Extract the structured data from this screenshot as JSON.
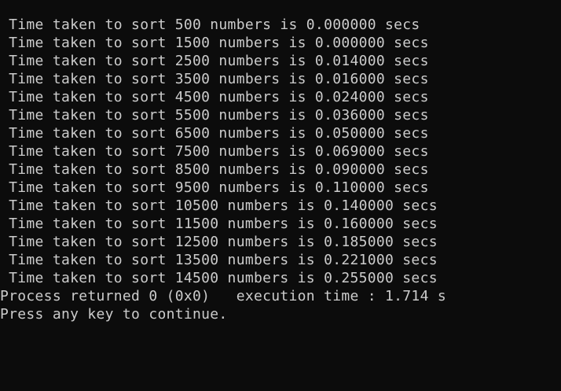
{
  "console": {
    "lines": [
      " Time taken to sort 500 numbers is 0.000000 secs",
      " Time taken to sort 1500 numbers is 0.000000 secs",
      " Time taken to sort 2500 numbers is 0.014000 secs",
      " Time taken to sort 3500 numbers is 0.016000 secs",
      " Time taken to sort 4500 numbers is 0.024000 secs",
      " Time taken to sort 5500 numbers is 0.036000 secs",
      " Time taken to sort 6500 numbers is 0.050000 secs",
      " Time taken to sort 7500 numbers is 0.069000 secs",
      " Time taken to sort 8500 numbers is 0.090000 secs",
      " Time taken to sort 9500 numbers is 0.110000 secs",
      " Time taken to sort 10500 numbers is 0.140000 secs",
      " Time taken to sort 11500 numbers is 0.160000 secs",
      " Time taken to sort 12500 numbers is 0.185000 secs",
      " Time taken to sort 13500 numbers is 0.221000 secs",
      " Time taken to sort 14500 numbers is 0.255000 secs",
      "Process returned 0 (0x0)   execution time : 1.714 s",
      "Press any key to continue."
    ],
    "colors": {
      "background": "#0c0c0c",
      "text": "#cccccc"
    }
  }
}
